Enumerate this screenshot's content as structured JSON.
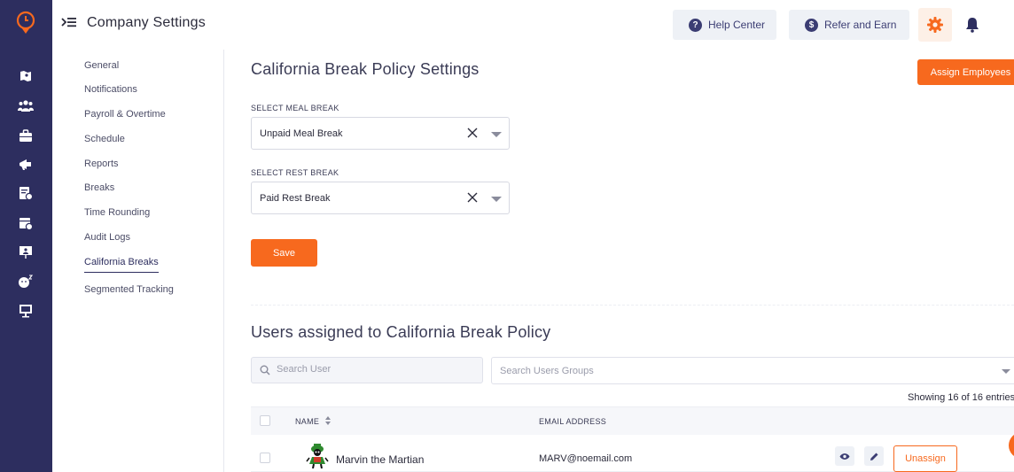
{
  "header": {
    "title": "Company Settings",
    "help_label": "Help Center",
    "refer_label": "Refer and Earn"
  },
  "rail": {
    "icons": [
      "map-icon",
      "team-icon",
      "briefcase-icon",
      "megaphone-icon",
      "timesheet-icon",
      "schedule-icon",
      "presentation-icon",
      "sleep-icon",
      "monitor-icon"
    ]
  },
  "subnav": {
    "items": [
      {
        "label": "General"
      },
      {
        "label": "Notifications"
      },
      {
        "label": "Payroll & Overtime"
      },
      {
        "label": "Schedule"
      },
      {
        "label": "Reports"
      },
      {
        "label": "Breaks"
      },
      {
        "label": "Time Rounding"
      },
      {
        "label": "Audit Logs"
      },
      {
        "label": "California Breaks"
      },
      {
        "label": "Segmented Tracking"
      }
    ],
    "active_item": "California Breaks"
  },
  "policy": {
    "title": "California Break Policy Settings",
    "assign_label": "Assign Employees",
    "meal_label": "SELECT MEAL BREAK",
    "meal_value": "Unpaid Meal Break",
    "rest_label": "SELECT REST BREAK",
    "rest_value": "Paid Rest Break",
    "save_label": "Save"
  },
  "users": {
    "title": "Users assigned to California Break Policy",
    "search_placeholder": "Search User",
    "groups_placeholder": "Search Users Groups",
    "showing": "Showing 16 of 16 entries",
    "columns": {
      "name": "NAME",
      "email": "EMAIL ADDRESS"
    },
    "rows": [
      {
        "name": "Marvin the Martian",
        "email": "MARV@noemail.com",
        "action_label": "Unassign"
      }
    ]
  },
  "colors": {
    "accent": "#f7691e",
    "rail": "#2d2e5f",
    "navy": "#3b3d73"
  }
}
